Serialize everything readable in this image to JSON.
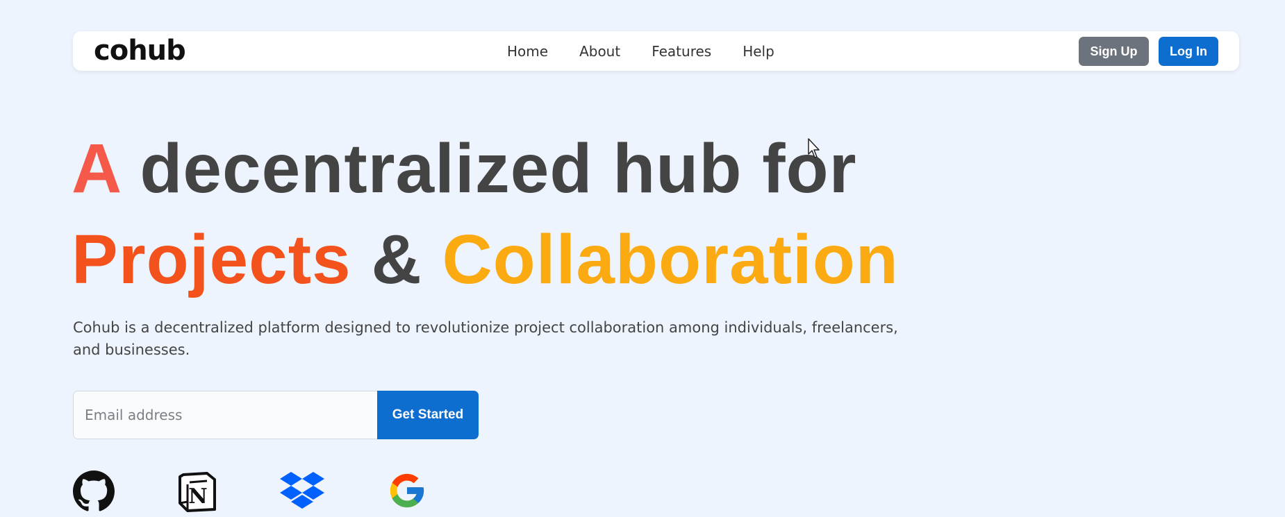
{
  "nav": {
    "logo_text": "cohub",
    "links": [
      "Home",
      "About",
      "Features",
      "Help"
    ],
    "signup_label": "Sign Up",
    "login_label": "Log In"
  },
  "hero": {
    "line1_accent": "A",
    "line1_rest": "decentralized hub for",
    "line2_word1": "Projects",
    "line2_amp": "&",
    "line2_word2": "Collaboration",
    "description": "Cohub is a decentralized platform designed to revolutionize project collaboration among individuals, freelancers, and businesses."
  },
  "signup": {
    "email_placeholder": "Email address",
    "cta_label": "Get Started"
  },
  "brands": [
    "github-icon",
    "notion-icon",
    "dropbox-icon",
    "google-icon"
  ],
  "colors": {
    "background": "#eef4fd",
    "primary": "#0d6ecf",
    "secondary": "#6c737c",
    "accent_a": "#f4594a",
    "accent_projects": "#f3521c",
    "accent_collab": "#fbaa12"
  }
}
